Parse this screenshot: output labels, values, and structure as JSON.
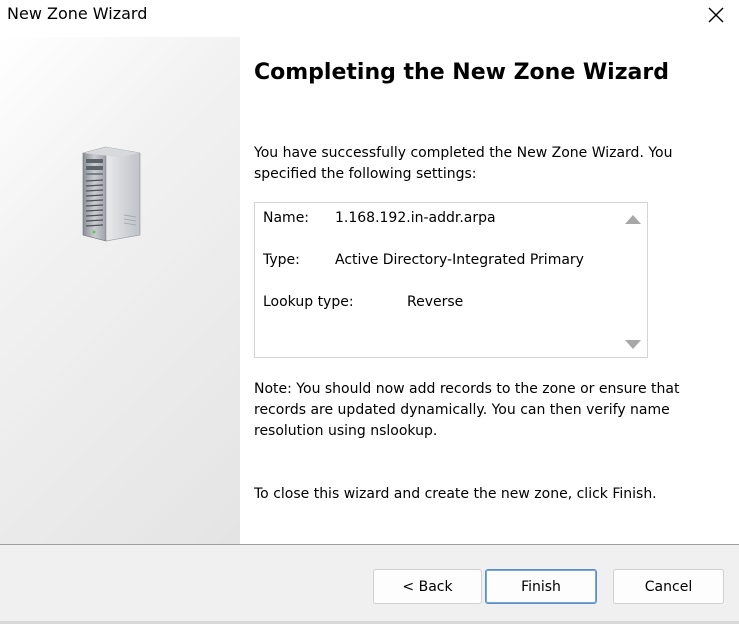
{
  "window": {
    "title": "New Zone Wizard",
    "close_icon": "close-icon"
  },
  "side_panel": {
    "icon": "server-tower-icon"
  },
  "main": {
    "heading": "Completing the New Zone Wizard",
    "intro": "You have successfully completed the New Zone Wizard. You specified the following settings:",
    "settings": {
      "name_label": "Name:",
      "name_value": "1.168.192.in-addr.arpa",
      "type_label": "Type:",
      "type_value": "Active Directory-Integrated Primary",
      "lookup_label": "Lookup type:",
      "lookup_value": "Reverse",
      "scroll_up_icon": "scroll-up-arrow-icon",
      "scroll_down_icon": "scroll-down-arrow-icon"
    },
    "note": "Note: You should now add records to the zone or ensure that records are updated dynamically. You can then verify name resolution using nslookup.",
    "closing": "To close this wizard and create the new zone, click Finish."
  },
  "footer": {
    "back_label": "< Back",
    "finish_label": "Finish",
    "cancel_label": "Cancel"
  },
  "colors": {
    "accent_focus": "#5b8fc9",
    "footer_bg": "#f0f0f0"
  }
}
